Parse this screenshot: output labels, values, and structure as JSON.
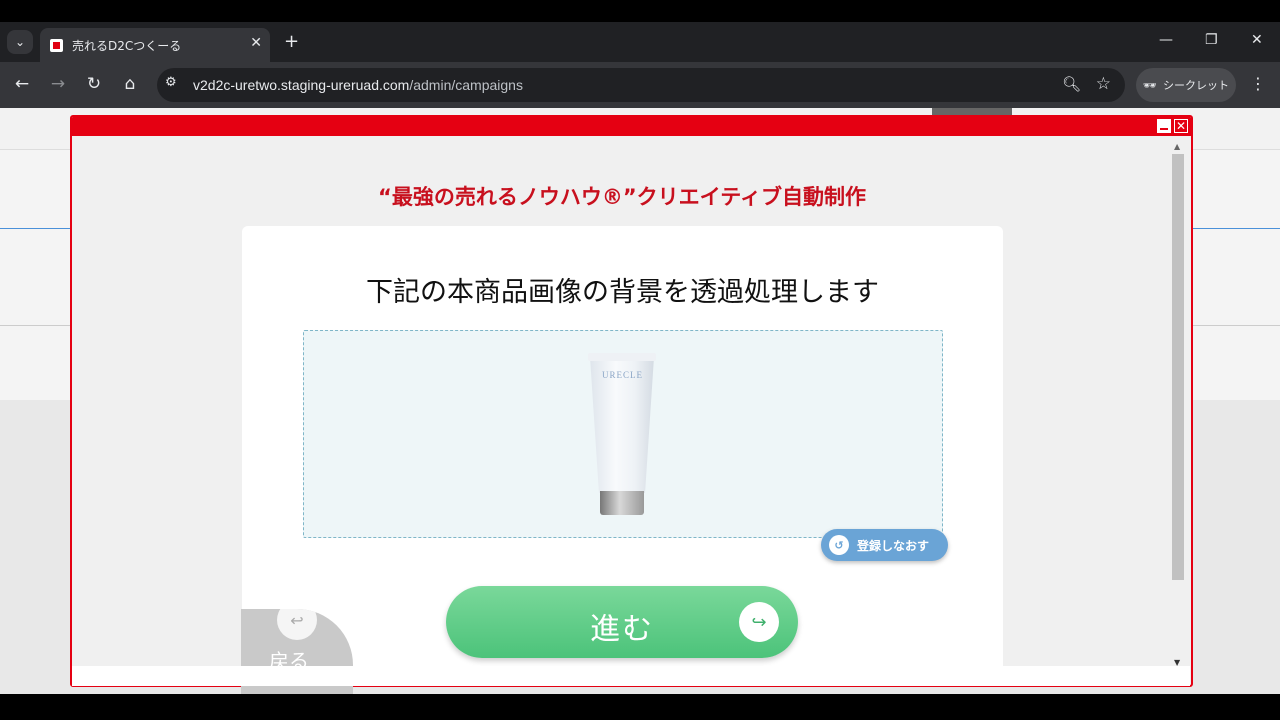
{
  "browser": {
    "tab_title": "売れるD2Cつくーる",
    "tab_close": "✕",
    "new_tab": "+",
    "url_host": "v2d2c-uretwo.staging-ureruad.com",
    "url_path": "/admin/campaigns",
    "incognito_label": "シークレット",
    "icons": [
      "back-icon",
      "forward-icon",
      "reload-icon",
      "home-icon",
      "site-info-icon",
      "zoom-icon",
      "bookmark-star-icon",
      "incognito-icon",
      "menu-icon"
    ]
  },
  "modal": {
    "title": "“最強の売れるノウハウ®”クリエイティブ自動制作",
    "accent_color": "#e50012",
    "card": {
      "heading": "下記の本商品画像の背景を透過処理します",
      "product_brand": "URECLE"
    },
    "redo_label": "登録しなおす",
    "next_label": "進む",
    "back_label": "戻る"
  }
}
